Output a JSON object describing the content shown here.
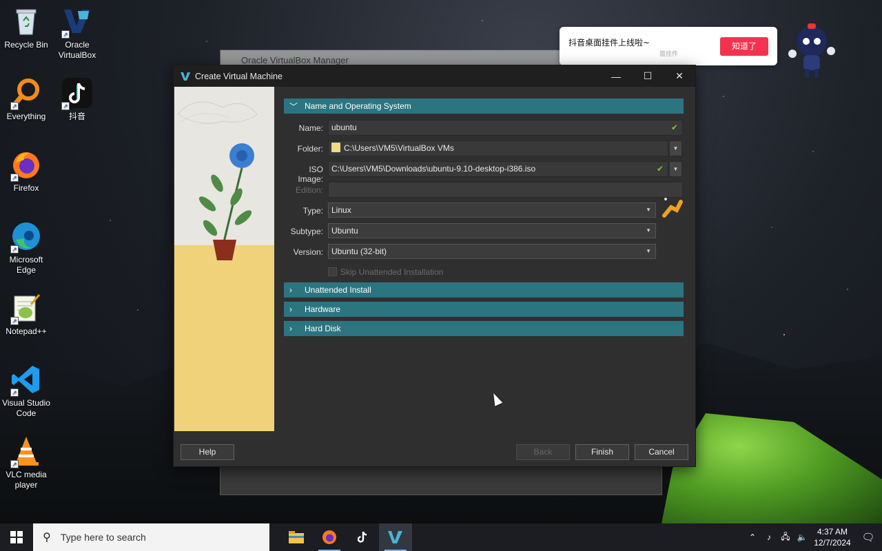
{
  "desktop": {
    "icons": [
      {
        "label": "Recycle Bin"
      },
      {
        "label": "Oracle VirtualBox"
      },
      {
        "label": "Everything"
      },
      {
        "label": "抖音"
      },
      {
        "label": "Firefox"
      },
      {
        "label": "Microsoft Edge"
      },
      {
        "label": "Notepad++"
      },
      {
        "label": "Visual Studio Code"
      },
      {
        "label": "VLC media player"
      }
    ]
  },
  "background_window": {
    "title": "Oracle VirtualBox Manager"
  },
  "toast": {
    "message": "抖音桌面挂件上线啦~",
    "subtext": "面挂件",
    "button": "知道了"
  },
  "dialog": {
    "title": "Create Virtual Machine",
    "sections": {
      "name_os": "Name and Operating System",
      "unattended": "Unattended Install",
      "hardware": "Hardware",
      "hard_disk": "Hard Disk"
    },
    "fields": {
      "name_label": "Name:",
      "name_value": "ubuntu",
      "folder_label": "Folder:",
      "folder_value": "C:\\Users\\VM5\\VirtualBox VMs",
      "iso_label": "ISO Image:",
      "iso_value": "C:\\Users\\VM5\\Downloads\\ubuntu-9.10-desktop-i386.iso",
      "edition_label": "Edition:",
      "edition_value": "",
      "type_label": "Type:",
      "type_value": "Linux",
      "subtype_label": "Subtype:",
      "subtype_value": "Ubuntu",
      "version_label": "Version:",
      "version_value": "Ubuntu (32-bit)",
      "skip_label": "Skip Unattended Installation"
    },
    "buttons": {
      "help": "Help",
      "back": "Back",
      "finish": "Finish",
      "cancel": "Cancel"
    }
  },
  "taskbar": {
    "search_placeholder": "Type here to search",
    "time": "4:37 AM",
    "date": "12/7/2024"
  },
  "colors": {
    "section_header": "#2d7481",
    "toast_button": "#f2324f",
    "check": "#7cc242"
  }
}
